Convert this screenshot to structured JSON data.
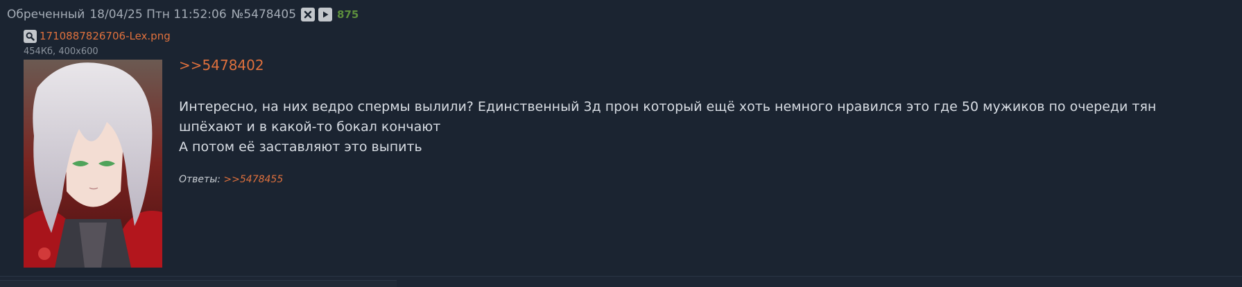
{
  "post": {
    "author": "Обреченный",
    "date": "18/04/25 Птн 11:52:06",
    "number": "№5478405",
    "score": "875",
    "file": {
      "name": "1710887826706-Lex.png",
      "meta": "454Кб, 400x600"
    },
    "reply_to": ">>5478402",
    "message_lines": [
      "Интересно, на них ведро спермы вылили? Единственный 3д прон который ещё хоть немного нравился это где 50 мужиков по очереди тян",
      "шпёхают и в какой-то бокал кончают",
      "А потом её заставляют это выпить"
    ],
    "replies_label": "Ответы:",
    "replies": [
      ">>5478455"
    ]
  },
  "colors": {
    "background": "#1b2431",
    "link": "#e0713d",
    "score": "#5d8f3d",
    "text": "#d8dde4"
  },
  "icons": {
    "hide": "close-icon",
    "play": "play-icon",
    "search": "search-icon"
  }
}
